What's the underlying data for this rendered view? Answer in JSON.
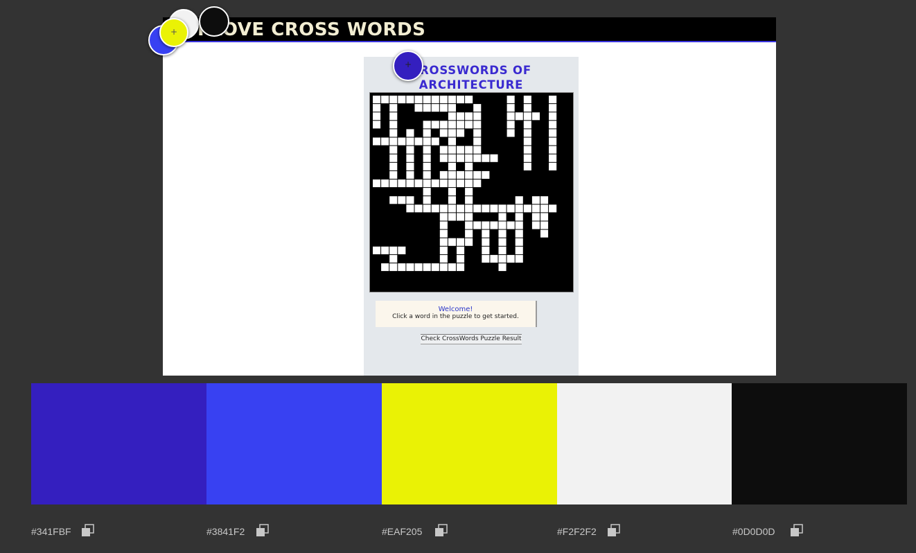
{
  "preview": {
    "site_title": "I LOVE CROSS WORDS",
    "puzzle_title_line1": "CROSSWORDS OF",
    "puzzle_title_line2": "ARCHITECTURE",
    "welcome_heading": "Welcome!",
    "welcome_text": "Click a word in the puzzle to get started.",
    "check_button": "Check CrossWords Puzzle Result"
  },
  "palette": {
    "swatches": [
      {
        "hex": "#341FBF",
        "label": "#341FBF"
      },
      {
        "hex": "#3841F2",
        "label": "#3841F2"
      },
      {
        "hex": "#EAF205",
        "label": "#EAF205"
      },
      {
        "hex": "#F2F2F2",
        "label": "#F2F2F2"
      },
      {
        "hex": "#0D0D0D",
        "label": "#0D0D0D"
      }
    ]
  },
  "handles": [
    {
      "name": "picker-handle-white",
      "color": "#F2F2F2"
    },
    {
      "name": "picker-handle-black",
      "color": "#0D0D0D"
    },
    {
      "name": "picker-handle-blue",
      "color": "#3841F2"
    },
    {
      "name": "picker-handle-yellow",
      "color": "#EAF205",
      "glyph": "+"
    },
    {
      "name": "picker-handle-purple",
      "color": "#341FBF",
      "glyph": "+"
    }
  ],
  "icons": {
    "copy": "copy-icon",
    "plus": "plus-icon"
  }
}
